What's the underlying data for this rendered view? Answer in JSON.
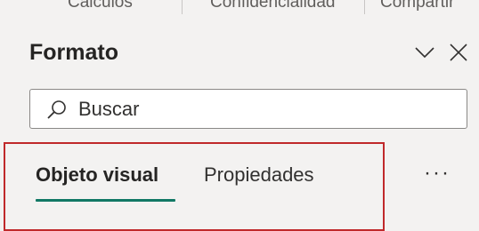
{
  "ribbon": {
    "items": [
      "Cálculos",
      "Confidencialidad",
      "Compartir"
    ]
  },
  "pane": {
    "title": "Formato"
  },
  "search": {
    "placeholder": "Buscar"
  },
  "tabs": [
    {
      "label": "Objeto visual",
      "active": true
    },
    {
      "label": "Propiedades",
      "active": false
    }
  ],
  "more_label": "···",
  "colors": {
    "accent": "#117865",
    "highlight": "#c0292b",
    "background": "#f3f2f1"
  }
}
